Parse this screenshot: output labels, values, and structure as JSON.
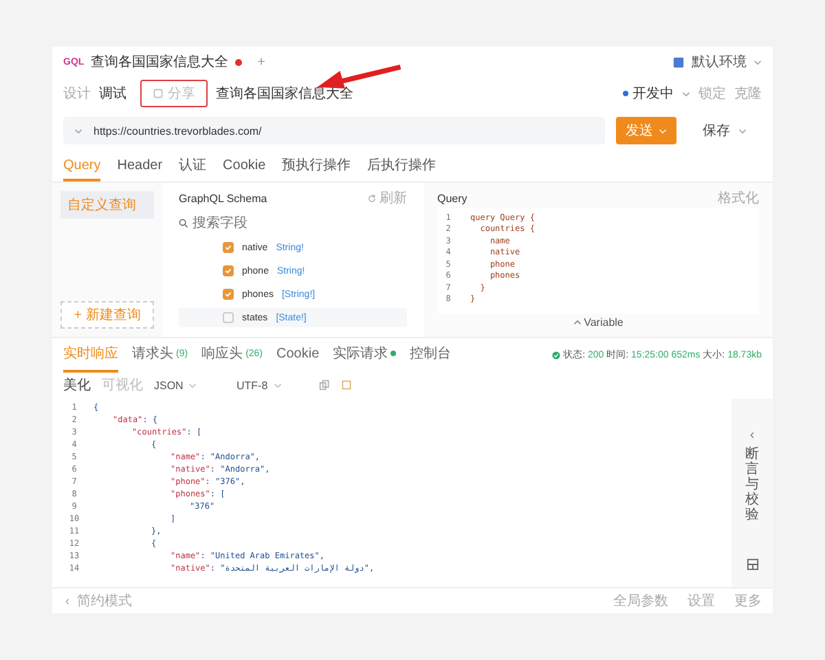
{
  "title_bar": {
    "logo": "GQL",
    "tab_title": "查询各国国家信息大全",
    "unsaved": true,
    "new_tab": "+",
    "environment": "默认环境"
  },
  "toolbar": {
    "modes": [
      {
        "label": "设计",
        "selected": false
      },
      {
        "label": "调试",
        "selected": true
      }
    ],
    "share": {
      "label": "分享",
      "highlighted": true,
      "arrow": true
    },
    "doc_title": "查询各国国家信息大全",
    "status": "开发中",
    "actions": [
      "锁定",
      "克隆"
    ]
  },
  "request": {
    "url": "https://countries.trevorblades.com/",
    "send": "发送",
    "save": "保存"
  },
  "tabs": [
    {
      "label": "Query",
      "selected": true
    },
    {
      "label": "Header",
      "selected": false
    },
    {
      "label": "认证",
      "selected": false
    },
    {
      "label": "Cookie",
      "selected": false
    },
    {
      "label": "预执行操作",
      "selected": false
    },
    {
      "label": "后执行操作",
      "selected": false
    }
  ],
  "queries": {
    "items": [
      {
        "label": "自定义查询",
        "selected": true
      }
    ],
    "new_button": "+ 新建查询"
  },
  "schema": {
    "title": "GraphQL Schema",
    "refresh": "刷新",
    "search_placeholder": "搜索字段",
    "fields": [
      {
        "name": "native",
        "type": "String!",
        "checked": true
      },
      {
        "name": "phone",
        "type": "String!",
        "checked": true
      },
      {
        "name": "phones",
        "type": "[String!]",
        "checked": true
      },
      {
        "name": "states",
        "type": "[State!]",
        "checked": false
      }
    ]
  },
  "query_editor": {
    "title": "Query",
    "format": "格式化",
    "lines": [
      {
        "n": "1",
        "text": "query Query {"
      },
      {
        "n": "2",
        "text": "  countries {"
      },
      {
        "n": "3",
        "text": "    name"
      },
      {
        "n": "4",
        "text": "    native"
      },
      {
        "n": "5",
        "text": "    phone"
      },
      {
        "n": "6",
        "text": "    phones"
      },
      {
        "n": "7",
        "text": "  }"
      },
      {
        "n": "8",
        "text": "}"
      }
    ],
    "variable": "Variable"
  },
  "response_tabs": [
    {
      "label": "实时响应",
      "selected": true,
      "dot": false
    },
    {
      "label": "请求头",
      "count": "(9)",
      "selected": false,
      "dot": false
    },
    {
      "label": "响应头",
      "count": "(26)",
      "selected": false,
      "dot": false
    },
    {
      "label": "Cookie",
      "selected": false,
      "dot": false
    },
    {
      "label": "实际请求",
      "selected": false,
      "dot": true
    },
    {
      "label": "控制台",
      "selected": false,
      "dot": false
    }
  ],
  "response_status": {
    "status_label": "状态:",
    "status": "200",
    "time_label": "时间:",
    "time": "15:25:00 652ms",
    "size_label": "大小:",
    "size": "18.73kb"
  },
  "response_toolbar": {
    "views": [
      {
        "label": "美化",
        "selected": true
      },
      {
        "label": "可视化",
        "selected": false
      }
    ],
    "format": "JSON",
    "encoding": "UTF-8"
  },
  "response_lines": [
    {
      "n": "1",
      "value": "{"
    },
    {
      "n": "2",
      "key": "\"data\"",
      "value": ": {"
    },
    {
      "n": "3",
      "key": "\"countries\"",
      "value": ": ["
    },
    {
      "n": "4",
      "value": "{"
    },
    {
      "n": "5",
      "key": "\"name\"",
      "value": ": \"Andorra\","
    },
    {
      "n": "6",
      "key": "\"native\"",
      "value": ": \"Andorra\","
    },
    {
      "n": "7",
      "key": "\"phone\"",
      "value": ": \"376\","
    },
    {
      "n": "8",
      "key": "\"phones\"",
      "value": ": ["
    },
    {
      "n": "9",
      "value": "\"376\""
    },
    {
      "n": "10",
      "value": "]"
    },
    {
      "n": "11",
      "value": "},"
    },
    {
      "n": "12",
      "value": "{"
    },
    {
      "n": "13",
      "key": "\"name\"",
      "value": ": \"United Arab Emirates\","
    },
    {
      "n": "14",
      "key": "\"native\"",
      "value": ": \"دولة الإمارات العربية المتحدة\","
    }
  ],
  "side_panel": {
    "label": "断言与校验"
  },
  "status_bar": {
    "left": "简约模式",
    "right": [
      "全局参数",
      "设置",
      "更多"
    ]
  }
}
